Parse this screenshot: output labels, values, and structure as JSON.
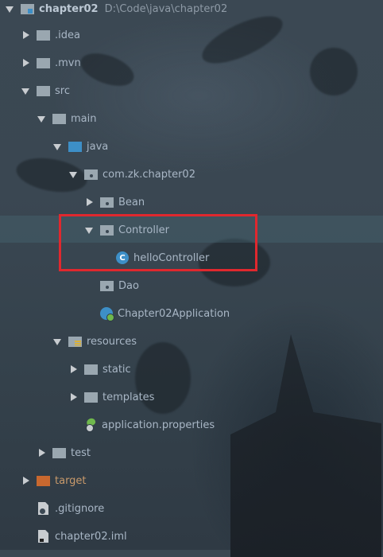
{
  "highlight_color": "#e0282e",
  "tree": {
    "root": {
      "label": "chapter02",
      "path": "D:\\Code\\java\\chapter02"
    },
    "items": [
      {
        "label": ".idea"
      },
      {
        "label": ".mvn"
      },
      {
        "label": "src"
      },
      {
        "label": "main"
      },
      {
        "label": "java"
      },
      {
        "label": "com.zk.chapter02"
      },
      {
        "label": "Bean"
      },
      {
        "label": "Controller"
      },
      {
        "label": "helloController",
        "icon_letter": "C"
      },
      {
        "label": "Dao"
      },
      {
        "label": "Chapter02Application"
      },
      {
        "label": "resources"
      },
      {
        "label": "static"
      },
      {
        "label": "templates"
      },
      {
        "label": "application.properties"
      },
      {
        "label": "test"
      },
      {
        "label": "target"
      },
      {
        "label": ".gitignore"
      },
      {
        "label": "chapter02.iml"
      }
    ]
  }
}
